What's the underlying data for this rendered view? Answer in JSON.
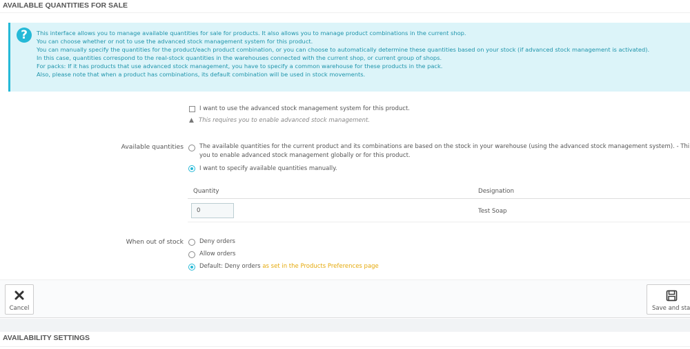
{
  "sections": {
    "quantities_title": "AVAILABLE QUANTITIES FOR SALE",
    "availability_title": "AVAILABILITY SETTINGS"
  },
  "alert": {
    "icon": "question-circle-icon",
    "lines": [
      "This interface allows you to manage available quantities for sale for products. It also allows you to manage product combinations in the current shop.",
      "You can choose whether or not to use the advanced stock management system for this product.",
      "You can manually specify the quantities for the product/each product combination, or you can choose to automatically determine these quantities based on your stock (if advanced stock management is activated).",
      "In this case, quantities correspond to the real-stock quantities in the warehouses connected with the current shop, or current group of shops.",
      "For packs: If it has products that use advanced stock management, you have to specify a common warehouse for these products in the pack.",
      "Also, please note that when a product has combinations, its default combination will be used in stock movements."
    ]
  },
  "advanced_stock": {
    "checkbox_label": "I want to use the advanced stock management system for this product.",
    "checked": false,
    "warning": "This requires you to enable advanced stock management."
  },
  "available_quantities": {
    "label": "Available quantities",
    "option_auto_line1": "The available quantities for the current product and its combinations are based on the stock in your warehouse (using the advanced stock management system).  - Thi",
    "option_auto_line2": "you to enable advanced stock management globally or for this product.",
    "option_manual": "I want to specify available quantities manually.",
    "selected": "manual"
  },
  "quantity_table": {
    "headers": [
      "Quantity",
      "Designation"
    ],
    "rows": [
      {
        "quantity": "0",
        "designation": "Test Soap"
      }
    ]
  },
  "out_of_stock": {
    "label": "When out of stock",
    "options": [
      "Deny orders",
      "Allow orders",
      "Default: Deny orders"
    ],
    "default_link": "as set in the Products Preferences page",
    "selected": 2
  },
  "footer": {
    "cancel_label": "Cancel",
    "save_label": "Save and stay"
  },
  "colors": {
    "accent": "#25b9d7",
    "link": "#e5a90a",
    "alert_bg": "#dcf4f9"
  }
}
